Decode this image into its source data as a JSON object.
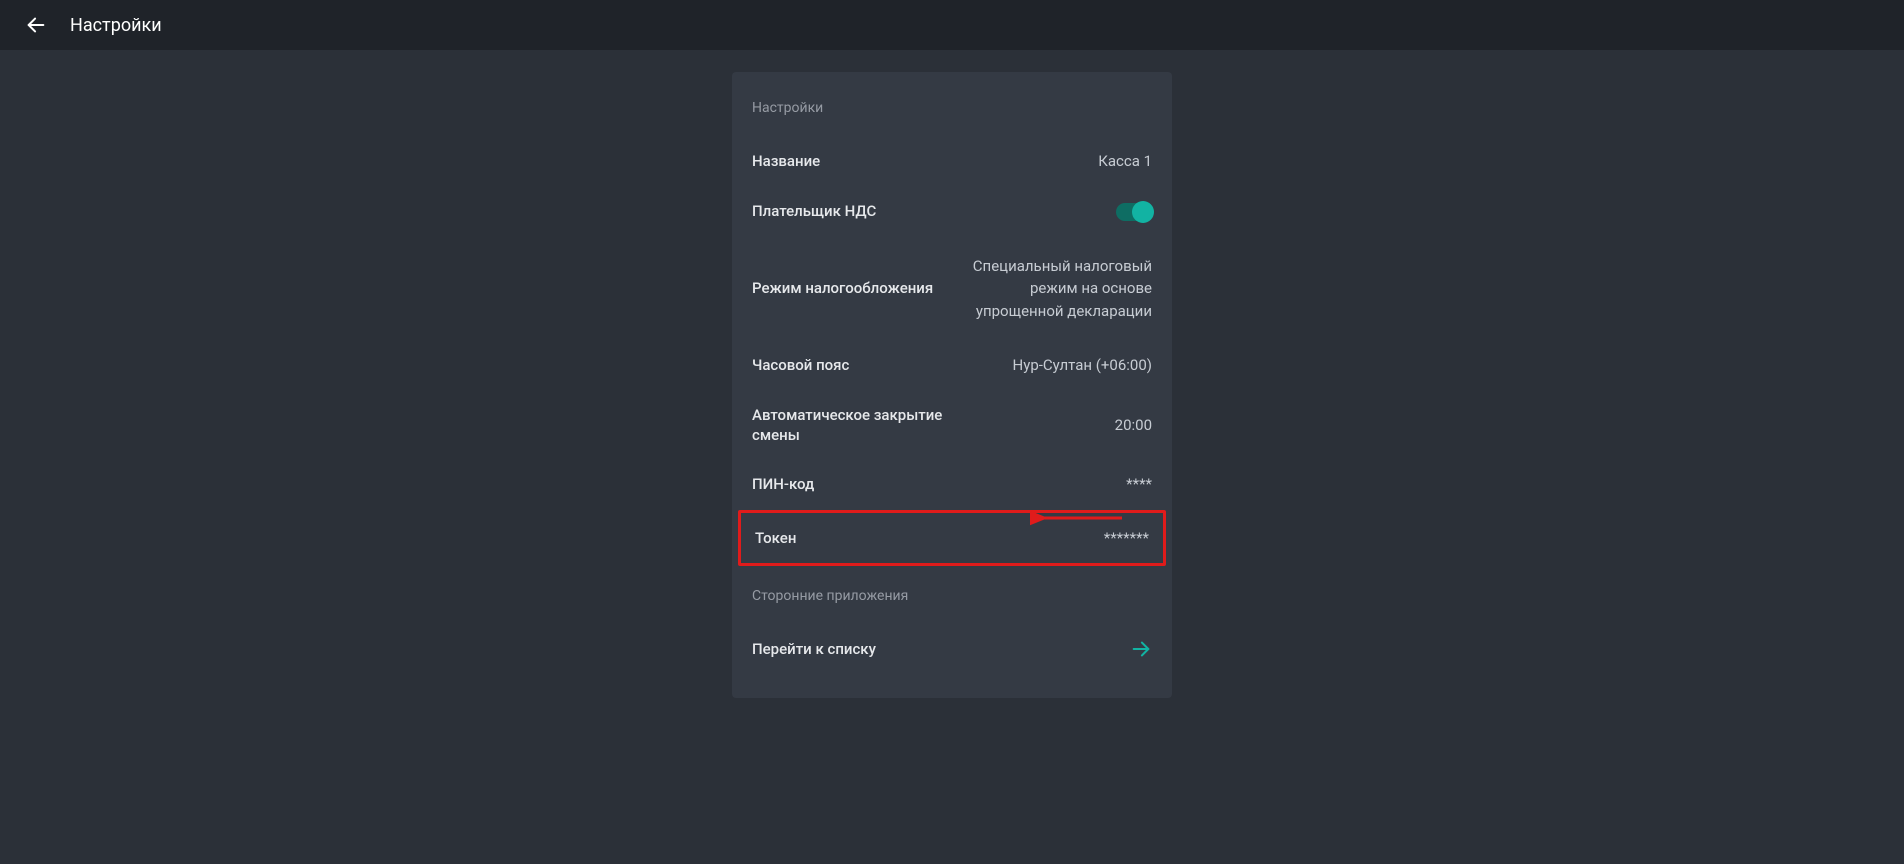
{
  "header": {
    "title": "Настройки"
  },
  "panel": {
    "section1_title": "Настройки",
    "rows": {
      "name": {
        "label": "Название",
        "value": "Касса 1"
      },
      "vat": {
        "label": "Плательщик НДС"
      },
      "tax_mode": {
        "label": "Режим налогообложения",
        "value": "Специальный налоговый режим на основе упрощенной декларации"
      },
      "timezone": {
        "label": "Часовой пояс",
        "value": "Нур-Султан (+06:00)"
      },
      "auto_close": {
        "label": "Автоматическое закрытие смены",
        "value": "20:00"
      },
      "pin": {
        "label": "ПИН-код",
        "value": "****"
      },
      "token": {
        "label": "Токен",
        "value": "*******"
      }
    },
    "section2_title": "Сторонние приложения",
    "go_list": {
      "label": "Перейти к списку"
    }
  },
  "colors": {
    "accent": "#12b3a3",
    "alert": "#e01b1b"
  }
}
